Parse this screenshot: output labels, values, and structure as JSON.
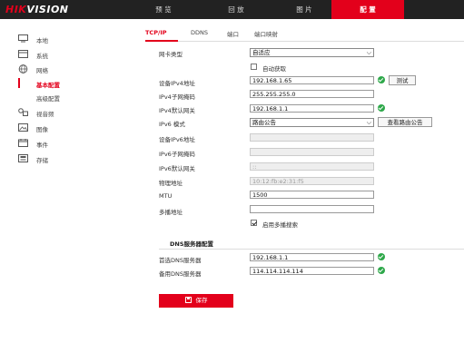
{
  "brand": {
    "logo_red": "HIK",
    "logo_white": "VISION"
  },
  "nav": {
    "tabs": [
      {
        "label": "预 览"
      },
      {
        "label": "回 放"
      },
      {
        "label": "图 片"
      },
      {
        "label": "配 置"
      }
    ],
    "active_index": 3
  },
  "sidebar": {
    "items": [
      {
        "label": "本地",
        "icon": "monitor-icon"
      },
      {
        "label": "系统",
        "icon": "system-icon"
      },
      {
        "label": "网络",
        "icon": "globe-icon"
      },
      {
        "label": "基本配置"
      },
      {
        "label": "高级配置"
      },
      {
        "label": "视音频",
        "icon": "audio-video-icon"
      },
      {
        "label": "图像",
        "icon": "image-icon"
      },
      {
        "label": "事件",
        "icon": "calendar-icon"
      },
      {
        "label": "存储",
        "icon": "storage-icon"
      }
    ],
    "active_sub": "基本配置"
  },
  "subtabs": {
    "items": [
      {
        "label": "TCP/IP"
      },
      {
        "label": "DDNS"
      },
      {
        "label": "端口"
      },
      {
        "label": "端口映射"
      }
    ],
    "active_index": 0
  },
  "form": {
    "nic_type": {
      "label": "网卡类型",
      "value": "自适应"
    },
    "auto_obtain": {
      "label": "自动获取",
      "checked": false
    },
    "ipv4_addr": {
      "label": "设备IPv4地址",
      "value": "192.168.1.65",
      "test_label": "测试"
    },
    "ipv4_mask": {
      "label": "IPv4子网掩码",
      "value": "255.255.255.0"
    },
    "ipv4_gw": {
      "label": "IPv4默认网关",
      "value": "192.168.1.1"
    },
    "ipv6_mode": {
      "label": "IPv6 模式",
      "value": "路由公告",
      "view_label": "查看路由公告"
    },
    "ipv6_addr": {
      "label": "设备IPv6地址",
      "value": ""
    },
    "ipv6_prefix": {
      "label": "IPv6子网掩码",
      "value": ""
    },
    "ipv6_gw": {
      "label": "IPv6默认网关",
      "value": "::"
    },
    "mac": {
      "label": "物理地址",
      "value": "10:12:fb:e2:31:f5"
    },
    "mtu": {
      "label": "MTU",
      "value": "1500"
    },
    "multicast": {
      "label": "多播地址",
      "value": ""
    },
    "enable_multicast": {
      "label": "启用多播搜索",
      "checked": true
    }
  },
  "dns": {
    "section_title": "DNS服务器配置",
    "preferred": {
      "label": "首选DNS服务器",
      "value": "192.168.1.1"
    },
    "alternate": {
      "label": "备用DNS服务器",
      "value": "114.114.114.114"
    }
  },
  "save_label": "保存",
  "colors": {
    "accent": "#e3001b",
    "ok": "#2ea84a",
    "topbar": "#222222"
  }
}
